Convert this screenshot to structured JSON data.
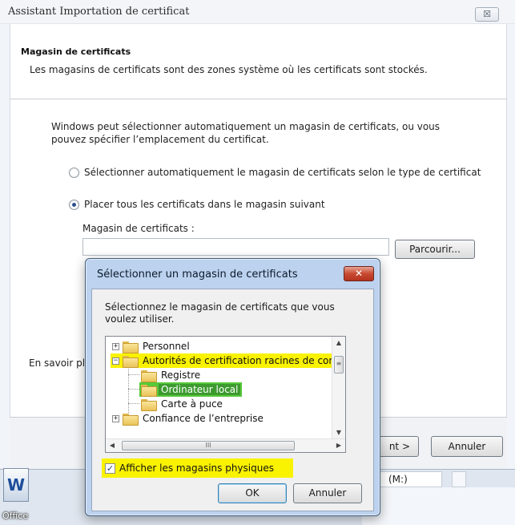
{
  "wizard": {
    "title": "Assistant Importation de certificat",
    "close_label": "☒",
    "section_title": "Magasin de certificats",
    "section_desc": "Les magasins de certificats sont des zones système où les certificats sont stockés.",
    "intro": "Windows peut sélectionner automatiquement un magasin de certificats, ou vous pouvez spécifier l’emplacement du certificat.",
    "radio_auto": "Sélectionner automatiquement le magasin de certificats selon le type de certificat",
    "radio_manual": "Placer tous les certificats dans le magasin suivant",
    "selected_option": "radio_manual",
    "store_label": "Magasin de certificats :",
    "store_value": "",
    "browse_button": "Parcourir...",
    "learn_more": "En savoir pl",
    "next_button": "nt >",
    "cancel_button": "Annuler"
  },
  "background": {
    "office_label": "Office",
    "drive_label": "(M:)"
  },
  "dialog": {
    "title": "Sélectionner un magasin de certificats",
    "close_label": "✕",
    "instruction": "Sélectionnez le magasin de certificats que vous voulez utiliser.",
    "tree": [
      {
        "label": "Personnel",
        "expander": "+",
        "level": 0,
        "state": "normal"
      },
      {
        "label": "Autorités de certification racines de conf",
        "expander": "−",
        "level": 0,
        "state": "highlighted"
      },
      {
        "label": "Registre",
        "expander": "",
        "level": 1,
        "state": "normal"
      },
      {
        "label": "Ordinateur local",
        "expander": "",
        "level": 1,
        "state": "selected"
      },
      {
        "label": "Carte à puce",
        "expander": "",
        "level": 1,
        "state": "normal"
      },
      {
        "label": "Confiance de l’entreprise",
        "expander": "+",
        "level": 0,
        "state": "normal"
      }
    ],
    "show_physical_label": "Afficher les magasins physiques",
    "show_physical_checked": true,
    "ok_button": "OK",
    "cancel_button": "Annuler"
  },
  "colors": {
    "highlight_yellow": "#f9f200",
    "selection_green": "#57c83a",
    "dialog_frame": "#bcd2ee",
    "close_red": "#c84a31"
  },
  "icons": [
    "close-icon",
    "folder-icon",
    "expander-plus-icon",
    "expander-minus-icon",
    "scroll-arrow-icon",
    "office-app-icon"
  ]
}
